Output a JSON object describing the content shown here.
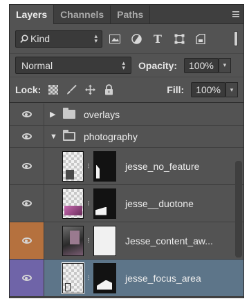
{
  "tabs": [
    {
      "label": "Layers",
      "active": true
    },
    {
      "label": "Channels",
      "active": false
    },
    {
      "label": "Paths",
      "active": false
    }
  ],
  "filter": {
    "kind_label": "Kind",
    "icons": [
      "image-filter-icon",
      "adjustment-filter-icon",
      "type-filter-icon",
      "shape-filter-icon",
      "smart-object-filter-icon"
    ],
    "type_glyph": "T"
  },
  "blend": {
    "mode": "Normal",
    "opacity_label": "Opacity:",
    "opacity_value": "100%"
  },
  "lock": {
    "label": "Lock:",
    "fill_label": "Fill:",
    "fill_value": "100%"
  },
  "layers": {
    "groups": [
      {
        "name": "overlays",
        "expanded": false
      },
      {
        "name": "photography",
        "expanded": true
      }
    ],
    "items": [
      {
        "name": "jesse_no_feature",
        "color_tag": "none",
        "selected": false
      },
      {
        "name": "jesse__duotone",
        "color_tag": "none",
        "selected": false
      },
      {
        "name": "Jesse_content_aw...",
        "color_tag": "#b5713e",
        "selected": false
      },
      {
        "name": "jesse_focus_area",
        "color_tag": "#6f64a8",
        "selected": true
      }
    ]
  },
  "colors": {
    "panel_bg": "#535353",
    "selected_row": "#5d7589",
    "orange_tag": "#b5713e",
    "violet_tag": "#6f64a8"
  }
}
